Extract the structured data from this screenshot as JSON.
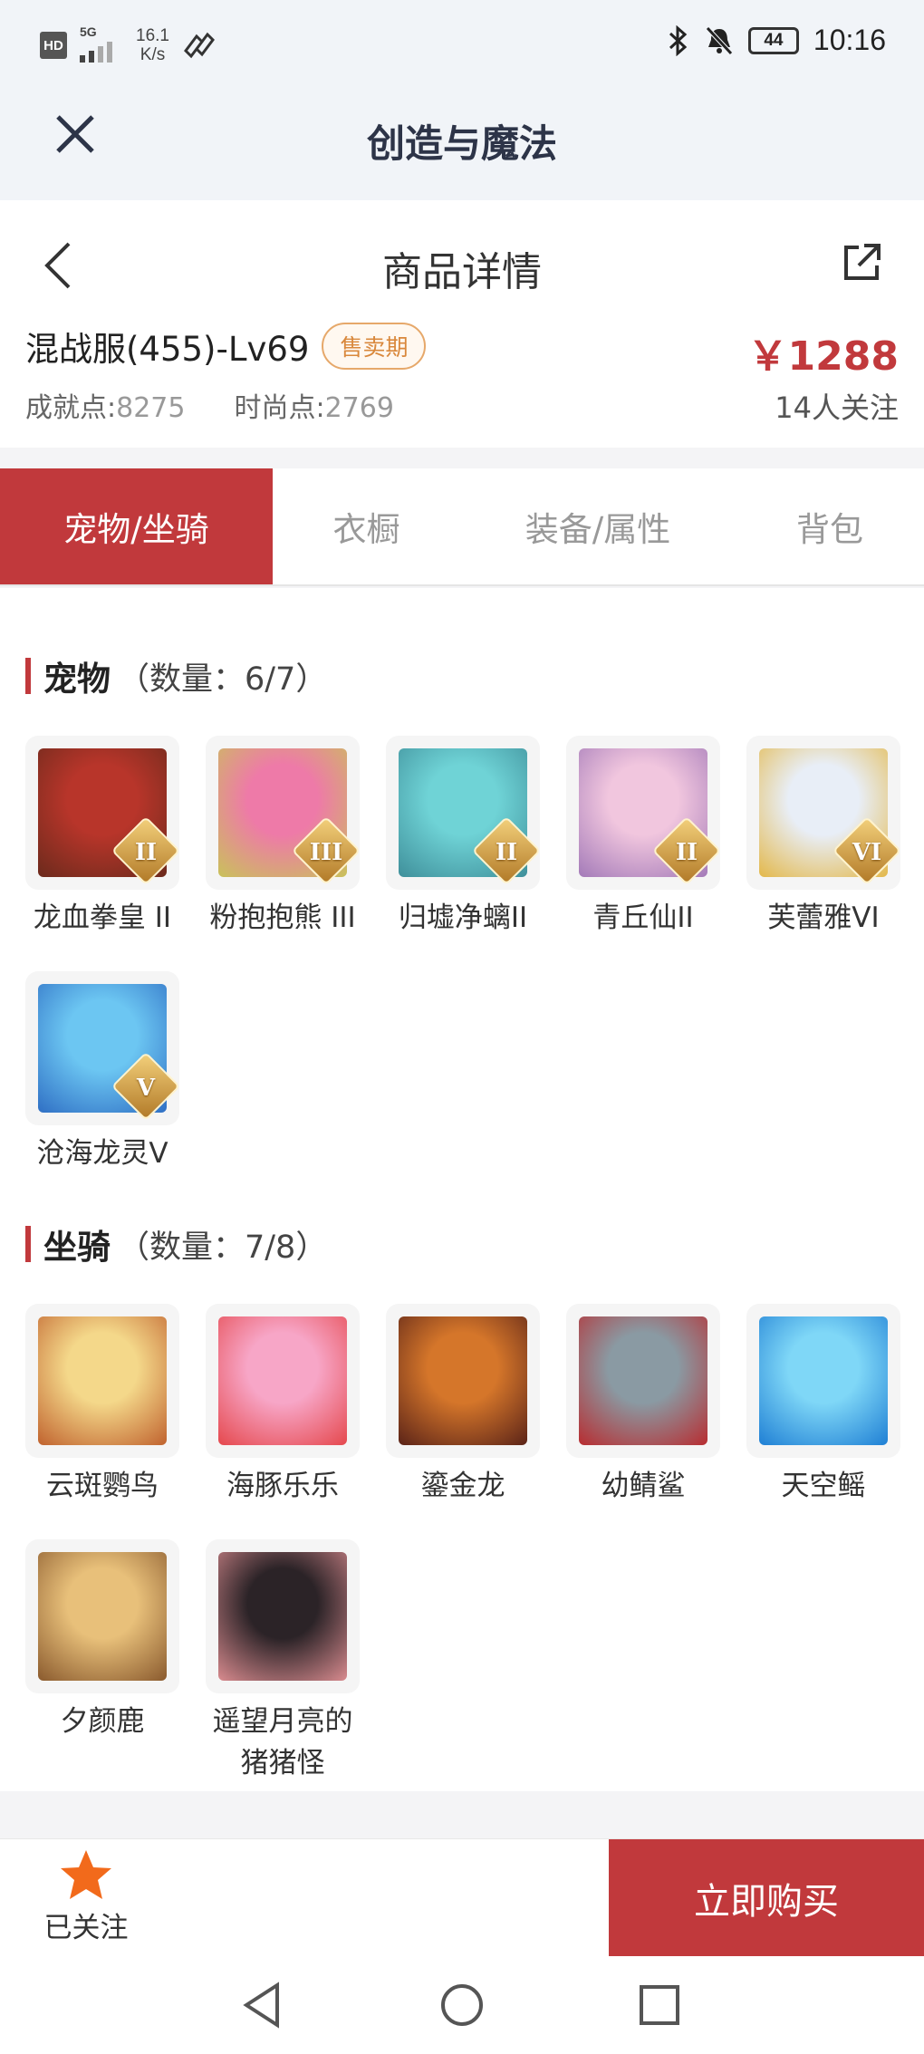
{
  "status_bar": {
    "hd": "HD",
    "network": "5G",
    "speed_value": "16.1",
    "speed_unit": "K/s",
    "battery": "44",
    "time": "10:16"
  },
  "app_header": {
    "title": "创造与魔法"
  },
  "nav": {
    "title": "商品详情"
  },
  "product": {
    "server": "混战服(455)-Lv69",
    "badge": "售卖期",
    "achievement_label": "成就点:",
    "achievement_value": "8275",
    "fashion_label": "时尚点:",
    "fashion_value": "2769",
    "price": "￥1288",
    "followers": "14人关注"
  },
  "tabs": [
    {
      "label": "宠物/坐骑",
      "active": true
    },
    {
      "label": "衣橱",
      "active": false
    },
    {
      "label": "装备/属性",
      "active": false
    },
    {
      "label": "背包",
      "active": false
    }
  ],
  "pets": {
    "title": "宠物",
    "count": "（数量：6/7）",
    "items": [
      {
        "name": "龙血拳皇 II",
        "grade": "II",
        "icon": "red-dragon-pet",
        "colors": [
          "#b8352a",
          "#6b2a1c"
        ]
      },
      {
        "name": "粉抱抱熊 III",
        "grade": "III",
        "icon": "pink-bear-pet",
        "colors": [
          "#ee7aa8",
          "#c9c25a"
        ]
      },
      {
        "name": "归墟净螭II",
        "grade": "II",
        "icon": "cyan-dragon-pet",
        "colors": [
          "#6fd3d6",
          "#3f8f9a"
        ]
      },
      {
        "name": "青丘仙II",
        "grade": "II",
        "icon": "fox-fairy-pet",
        "colors": [
          "#f1c6de",
          "#a37ab8"
        ]
      },
      {
        "name": "芙蕾雅VI",
        "grade": "VI",
        "icon": "freya-pet",
        "colors": [
          "#e8eef7",
          "#e3b84a"
        ]
      },
      {
        "name": "沧海龙灵V",
        "grade": "V",
        "icon": "sea-dragon-spirit-pet",
        "colors": [
          "#6cc6f2",
          "#2f6fc4"
        ]
      }
    ]
  },
  "mounts": {
    "title": "坐骑",
    "count": "（数量：7/8）",
    "items": [
      {
        "name": "云斑鹦鸟",
        "icon": "parrot-mount",
        "colors": [
          "#f4d88a",
          "#c0622e"
        ]
      },
      {
        "name": "海豚乐乐",
        "icon": "dolphin-mount",
        "colors": [
          "#f7a6c7",
          "#e5484d"
        ]
      },
      {
        "name": "鎏金龙",
        "icon": "golden-dragon-mount",
        "colors": [
          "#d5762a",
          "#5a2318"
        ]
      },
      {
        "name": "幼鲭鲨",
        "icon": "shark-mount",
        "colors": [
          "#8a9aa3",
          "#b82c30"
        ]
      },
      {
        "name": "天空鳐",
        "icon": "sky-ray-mount",
        "colors": [
          "#7fd7f7",
          "#1f7fd4"
        ]
      },
      {
        "name": "夕颜鹿",
        "icon": "deer-mount",
        "colors": [
          "#e8c07a",
          "#8a5a2e"
        ]
      },
      {
        "name": "遥望月亮的\n猪猪怪",
        "name_line1": "遥望月亮的",
        "name_line2": "猪猪怪",
        "icon": "pig-mount",
        "colors": [
          "#2b2327",
          "#d98b8f"
        ]
      }
    ]
  },
  "bottom": {
    "follow_label": "已关注",
    "buy_label": "立即购买"
  },
  "theme": {
    "accent": "#c1393c",
    "badge": "#d9883c",
    "star": "#f26a1b"
  }
}
